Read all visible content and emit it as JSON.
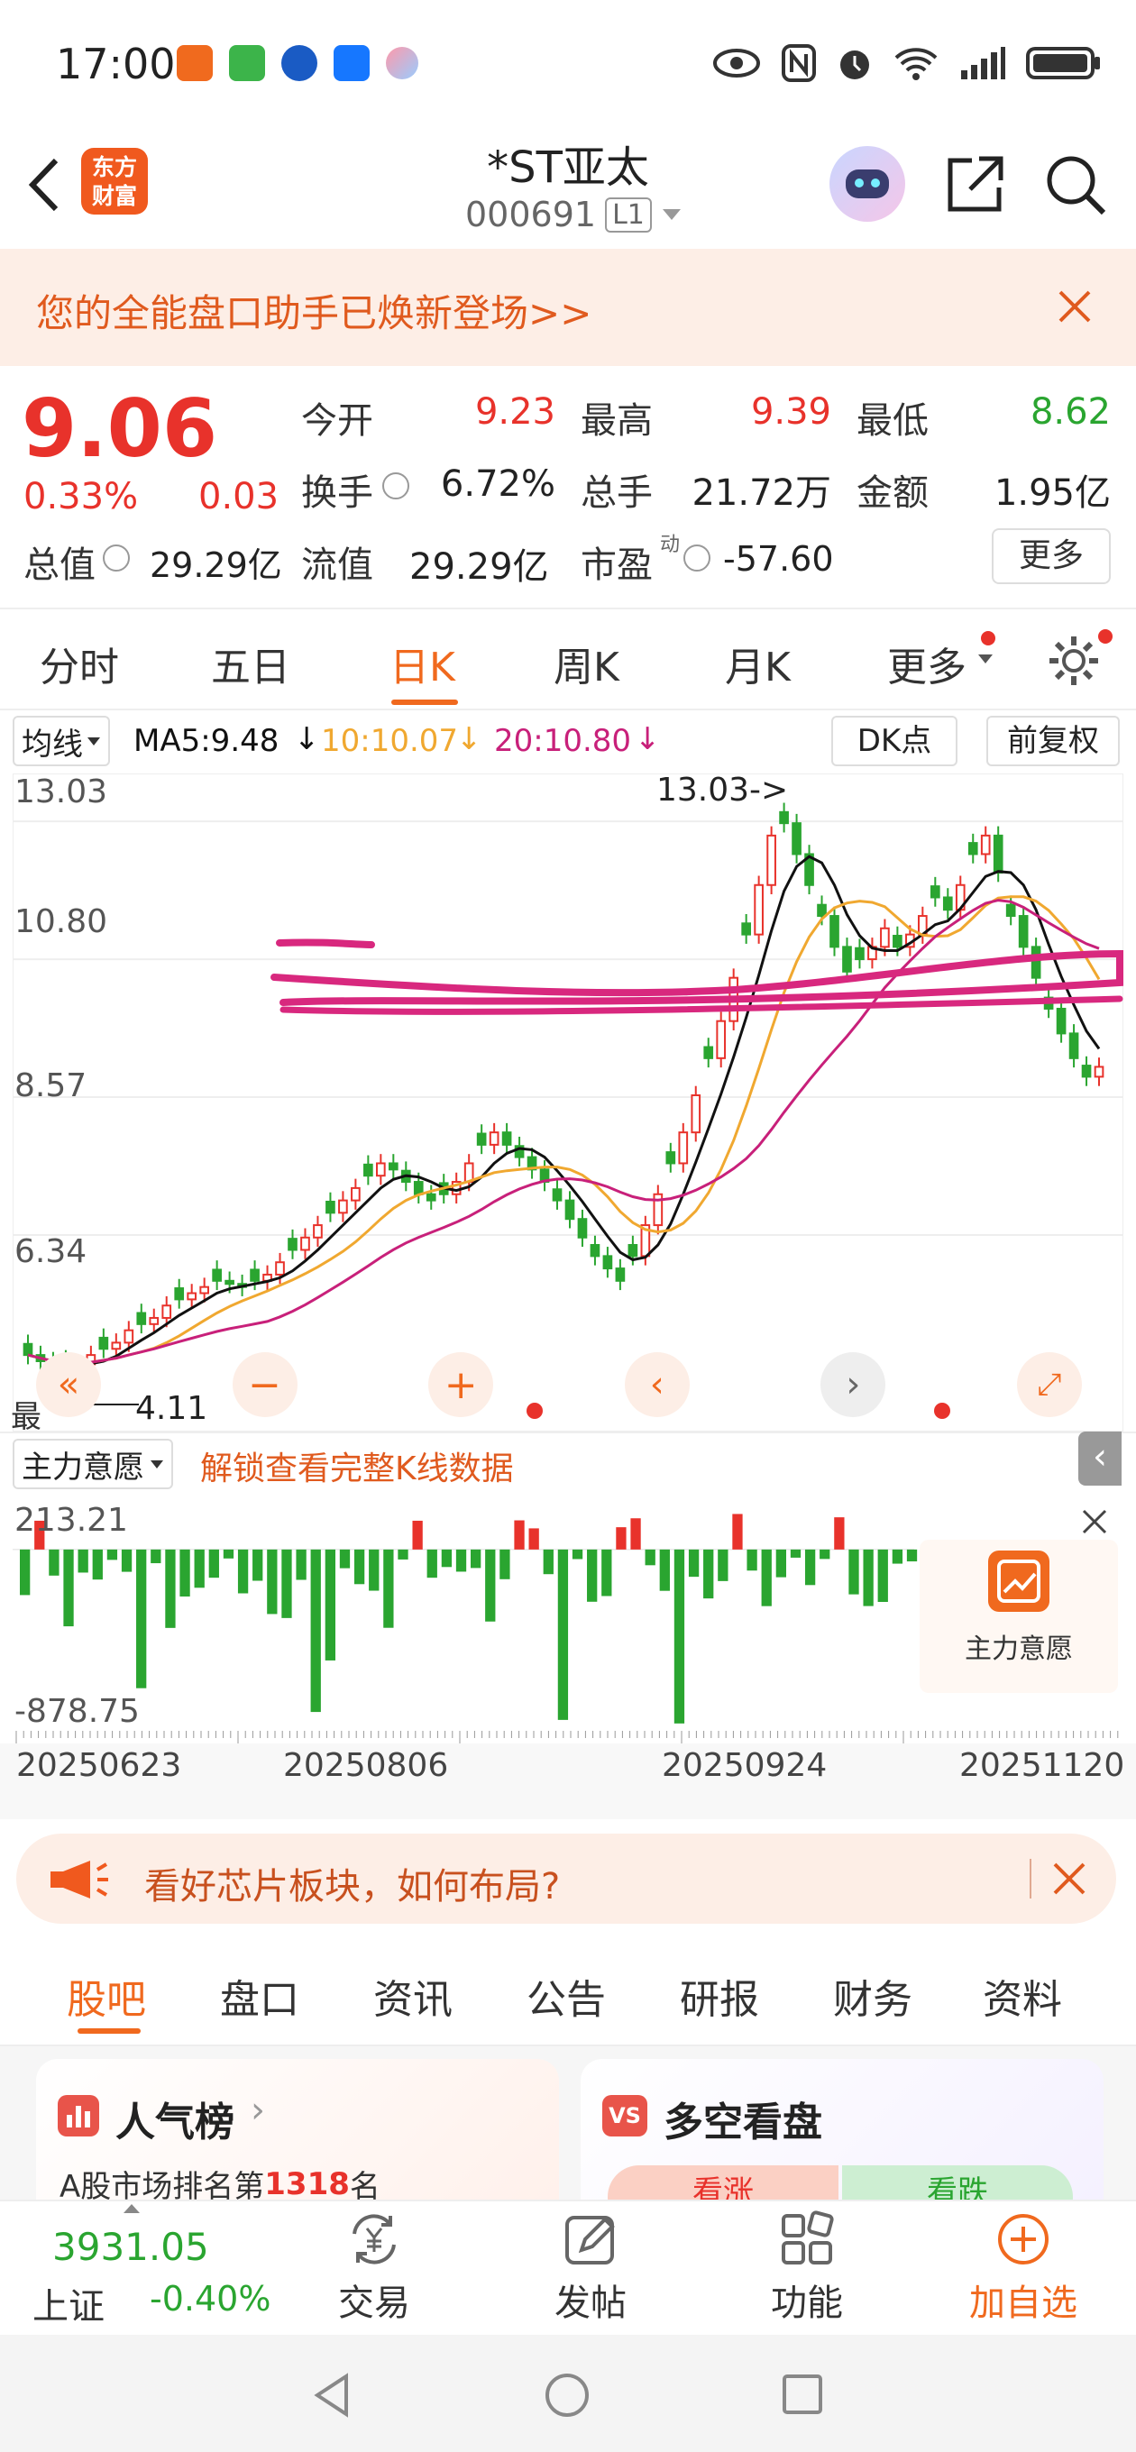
{
  "status_bar": {
    "time": "17:00"
  },
  "header": {
    "logo_text": [
      "东方",
      "财富"
    ],
    "stock_name": "*ST亚太",
    "stock_code": "000691",
    "level": "L1"
  },
  "banner": {
    "text": "您的全能盘口助手已焕新登场>>"
  },
  "quote": {
    "price": "9.06",
    "change_pct": "0.33%",
    "change": "0.03",
    "open_label": "今开",
    "open": "9.23",
    "high_label": "最高",
    "high": "9.39",
    "low_label": "最低",
    "low": "8.62",
    "turnover_label": "换手",
    "turnover": "6.72%",
    "volume_label": "总手",
    "volume": "21.72万",
    "amount_label": "金额",
    "amount": "1.95亿",
    "mktcap_label": "总值",
    "mktcap": "29.29亿",
    "float_label": "流值",
    "float_cap": "29.29亿",
    "pe_label": "市盈",
    "pe_sup": "动",
    "pe": "-57.60",
    "more_button": "更多"
  },
  "tabs": [
    "分时",
    "五日",
    "日K",
    "周K",
    "月K",
    "更多"
  ],
  "active_tab": "日K",
  "chart": {
    "ma_selector": "均线",
    "ma5": "MA5:9.48",
    "ma10": "10:10.07",
    "ma20": "20:10.80",
    "dk_button": "DK点",
    "adjust_button": "前复权",
    "ma5_color": "#111111",
    "ma10_color": "#f0a830",
    "ma20_color": "#c8207a",
    "up_color": "#e8322b",
    "down_color": "#2aa530",
    "y_ticks": [
      "13.03",
      "10.80",
      "8.57",
      "6.34"
    ],
    "high_annotation": "13.03->",
    "low_annotation": "4.11",
    "low_prefix": "最",
    "indicator_selector": "主力意愿",
    "unlock_text": "解锁查看完整K线数据",
    "indicator_ticks": [
      "213.21",
      "-878.75"
    ],
    "indicator_badge": "主力意愿",
    "x_ticks": [
      "20250623",
      "20250806",
      "20250924",
      "20251120"
    ]
  },
  "chart_data": {
    "type": "candlestick",
    "y_range": [
      4.11,
      13.03
    ],
    "x_dates": [
      "20250623",
      "20250806",
      "20250924",
      "20251120"
    ],
    "closes": [
      4.4,
      4.3,
      4.2,
      4.15,
      4.25,
      4.4,
      4.5,
      4.6,
      4.8,
      4.9,
      5.0,
      5.2,
      5.3,
      5.4,
      5.5,
      5.6,
      5.55,
      5.5,
      5.6,
      5.7,
      5.9,
      6.1,
      6.3,
      6.5,
      6.7,
      6.9,
      7.1,
      7.3,
      7.5,
      7.4,
      7.2,
      7.0,
      6.9,
      7.0,
      7.2,
      7.5,
      7.8,
      8.0,
      7.8,
      7.6,
      7.4,
      7.2,
      6.9,
      6.6,
      6.3,
      6.0,
      5.8,
      5.6,
      6.0,
      6.5,
      7.0,
      7.5,
      8.0,
      8.6,
      9.2,
      9.8,
      10.5,
      11.2,
      12.0,
      12.8,
      13.0,
      12.5,
      12.0,
      11.5,
      11.0,
      10.6,
      10.8,
      11.0,
      11.3,
      11.0,
      11.2,
      11.5,
      11.8,
      11.6,
      12.0,
      12.5,
      12.8,
      12.2,
      11.5,
      11.0,
      10.5,
      10.0,
      9.6,
      9.2,
      8.9,
      9.06
    ],
    "ma5_start": 4.3,
    "indicator": {
      "name": "主力意愿",
      "range": [
        -878.75,
        213.21
      ]
    }
  },
  "ad_banner": {
    "text": "看好芯片板块，如何布局?"
  },
  "sub_tabs": [
    "股吧",
    "盘口",
    "资讯",
    "公告",
    "研报",
    "财务",
    "资料"
  ],
  "active_sub_tab": "股吧",
  "cards": {
    "popularity_title": "人气榜",
    "popularity_rank_prefix": "A股市场排名第",
    "popularity_rank": "1318",
    "popularity_rank_suffix": "名",
    "bull_bear_title": "多空看盘",
    "bull_label": "看涨",
    "bear_label": "看跌"
  },
  "bottom_bar": {
    "index_value": "3931.05",
    "index_name": "上证",
    "index_change": "-0.40%",
    "trade": "交易",
    "post": "发帖",
    "functions": "功能",
    "add_watch": "加自选"
  }
}
